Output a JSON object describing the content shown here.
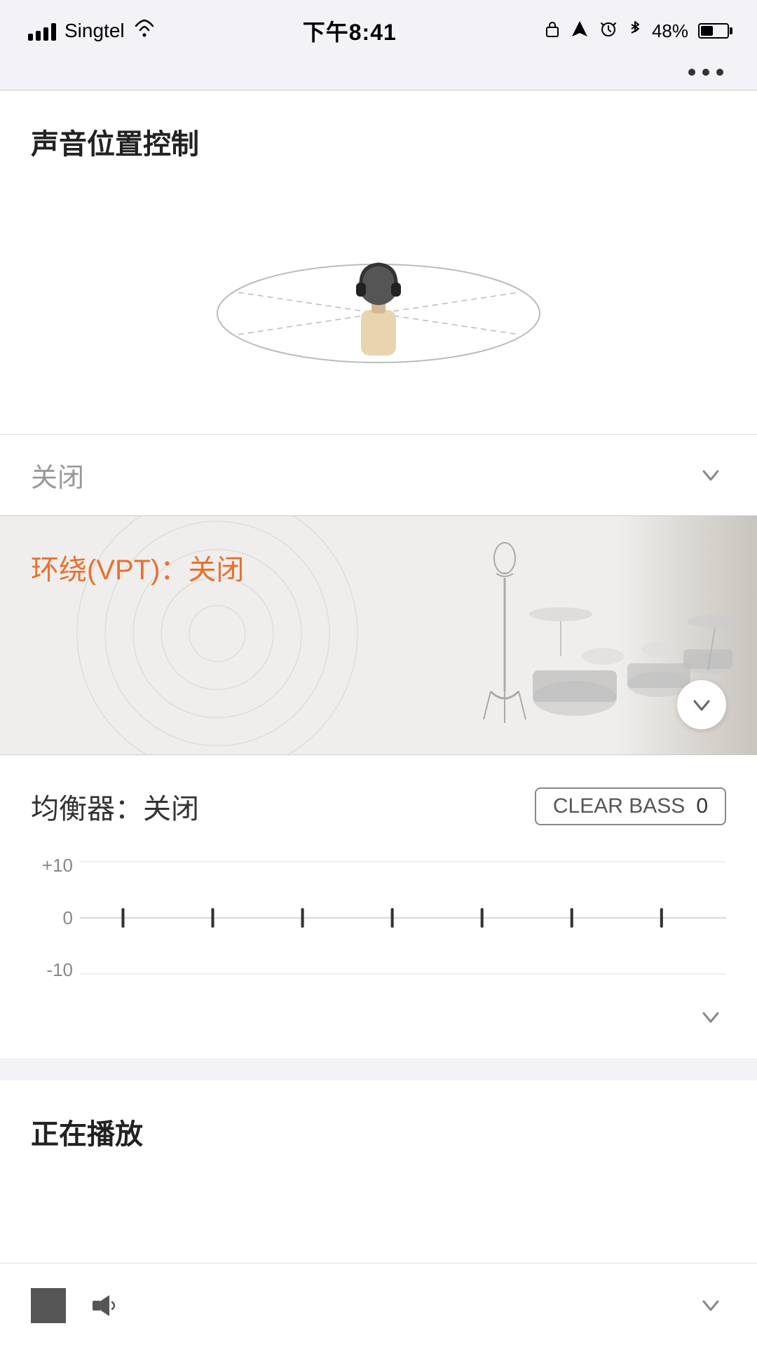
{
  "statusBar": {
    "carrier": "Singtel",
    "time": "下午8:41",
    "batteryPercent": "48%"
  },
  "sections": {
    "soundPosition": {
      "title": "声音位置控制",
      "dropdownValue": "关闭"
    },
    "vpt": {
      "title": "环绕(VPT)：",
      "value": "关闭"
    },
    "equalizer": {
      "title": "均衡器：",
      "value": "关闭",
      "clearBassLabel": "CLEAR BASS",
      "clearBassValue": "0"
    },
    "playingNow": {
      "title": "正在播放"
    }
  },
  "chevronSymbol": "∨",
  "eqYLabels": [
    "+10",
    "0",
    "-10"
  ],
  "eqBands": [
    0,
    0,
    0,
    0,
    0,
    0,
    0
  ]
}
